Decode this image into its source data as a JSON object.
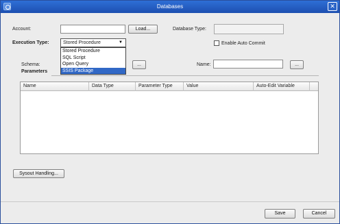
{
  "window": {
    "title": "Databases",
    "close_glyph": "✕",
    "app_icon": "database-app-icon"
  },
  "form": {
    "account_label": "Account:",
    "account_value": "",
    "load_button": "Load...",
    "database_type_label": "Database Type:",
    "database_type_value": "",
    "execution_type_label": "Execution Type:",
    "execution_type_value": "Stored Procedure",
    "execution_type_options": [
      "Stored Procedure",
      "SQL Script",
      "Open Query",
      "SSIS Package"
    ],
    "execution_type_highlighted": "SSIS Package",
    "enable_auto_commit_label": "Enable Auto Commit",
    "enable_auto_commit_checked": false,
    "schema_label": "Schema:",
    "schema_browse_button": "...",
    "name_label": "Name:",
    "name_value": "",
    "name_browse_button": "...",
    "parameters_heading": "Parameters"
  },
  "parameters_table": {
    "columns": [
      "Name",
      "Data Type",
      "Parameter Type",
      "Value",
      "Auto-Edit Variable"
    ],
    "rows": []
  },
  "buttons": {
    "sysout_handling": "Sysout Handling...",
    "save": "Save",
    "cancel": "Cancel"
  },
  "colors": {
    "titlebar": "#1d4fb0",
    "selection": "#3168c6",
    "dialog_background": "#ececec"
  }
}
